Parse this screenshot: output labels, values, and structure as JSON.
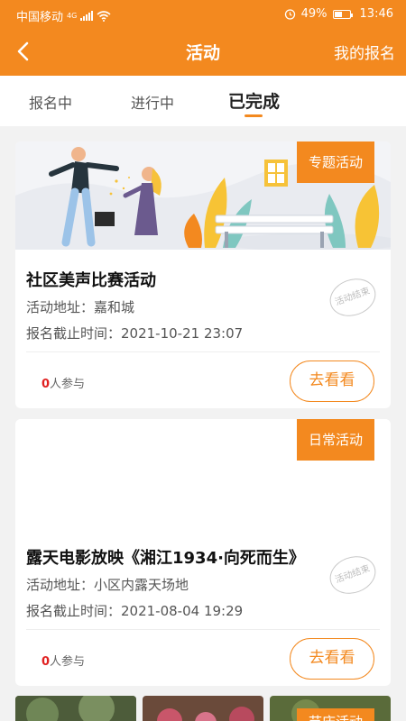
{
  "status_bar": {
    "carrier": "中国移动",
    "network": "4G",
    "battery": "49%",
    "time": "13:46"
  },
  "header": {
    "title": "活动",
    "right_action": "我的报名"
  },
  "tabs": [
    {
      "label": "报名中"
    },
    {
      "label": "进行中"
    },
    {
      "label": "已完成",
      "active": true
    }
  ],
  "cards": [
    {
      "tag": "专题活动",
      "title": "社区美声比赛活动",
      "address": "活动地址：嘉和城",
      "deadline": "报名截止时间：2021-10-21 23:07",
      "stamp": "活动结束",
      "participants_count": "0",
      "participants_suffix": "人参与",
      "button": "去看看"
    },
    {
      "tag": "日常活动",
      "title": "露天电影放映《湘江1934·向死而生》",
      "address": "活动地址：小区内露天场地",
      "deadline": "报名截止时间：2021-08-04 19:29",
      "stamp": "活动结束",
      "participants_count": "0",
      "participants_suffix": "人参与",
      "button": "去看看"
    },
    {
      "tag": "节庆活动"
    }
  ],
  "colors": {
    "accent": "#f3891f",
    "count": "#e02020"
  }
}
